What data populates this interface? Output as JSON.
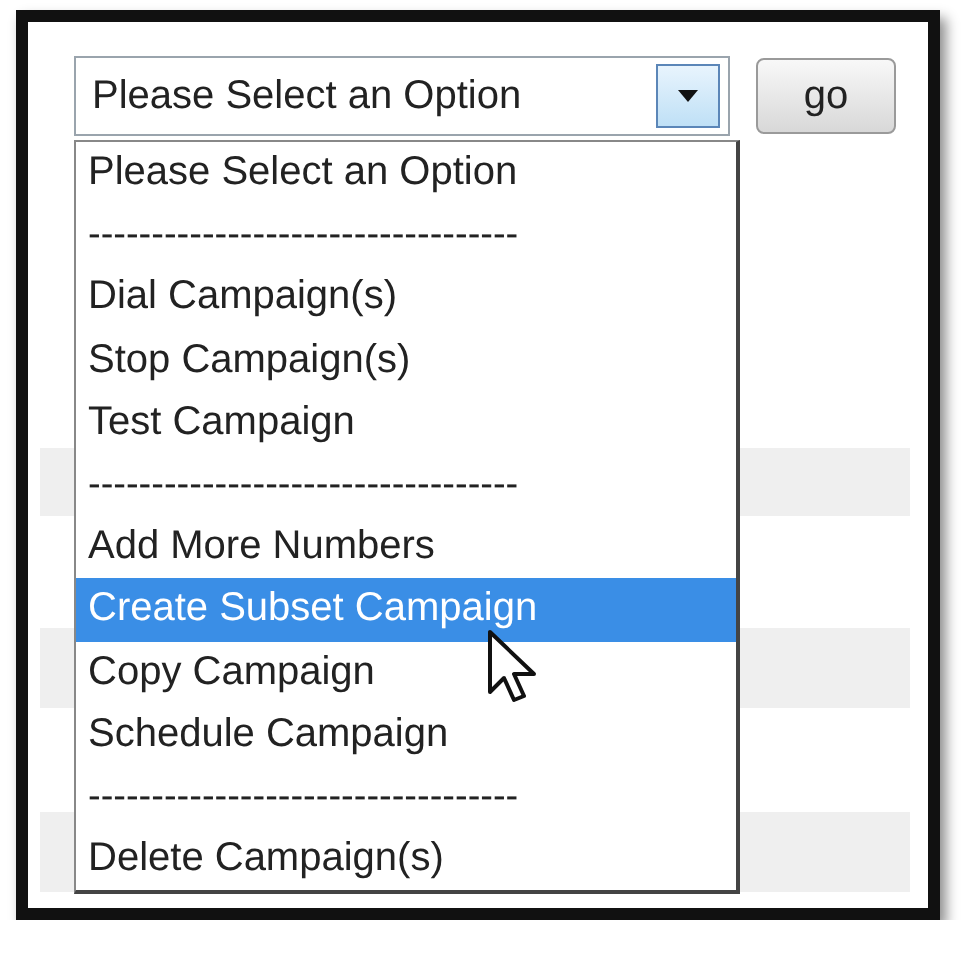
{
  "select": {
    "value": "Please Select an Option",
    "expanded": true
  },
  "go_button": {
    "label": "go"
  },
  "options": [
    {
      "kind": "option",
      "label": "Please Select an Option",
      "selected": false
    },
    {
      "kind": "separator",
      "label": "----------------------------------",
      "selected": false
    },
    {
      "kind": "option",
      "label": "Dial Campaign(s)",
      "selected": false
    },
    {
      "kind": "option",
      "label": "Stop Campaign(s)",
      "selected": false
    },
    {
      "kind": "option",
      "label": "Test Campaign",
      "selected": false
    },
    {
      "kind": "separator",
      "label": "----------------------------------",
      "selected": false
    },
    {
      "kind": "option",
      "label": "Add More Numbers",
      "selected": false
    },
    {
      "kind": "option",
      "label": "Create Subset Campaign",
      "selected": true
    },
    {
      "kind": "option",
      "label": "Copy Campaign",
      "selected": false
    },
    {
      "kind": "option",
      "label": "Schedule Campaign",
      "selected": false
    },
    {
      "kind": "separator",
      "label": "----------------------------------",
      "selected": false
    },
    {
      "kind": "option",
      "label": "Delete Campaign(s)",
      "selected": false
    }
  ]
}
